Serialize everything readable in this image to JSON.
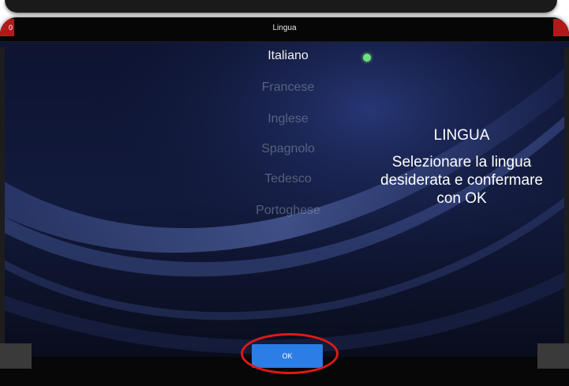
{
  "window": {
    "title": "Lingua",
    "left_badge": "0"
  },
  "languages": [
    {
      "label": "Italiano",
      "selected": true
    },
    {
      "label": "Francese",
      "selected": false
    },
    {
      "label": "Inglese",
      "selected": false
    },
    {
      "label": "Spagnolo",
      "selected": false
    },
    {
      "label": "Tedesco",
      "selected": false
    },
    {
      "label": "Portoghese",
      "selected": false
    }
  ],
  "help": {
    "title": "LINGUA",
    "body": "Selezionare la lingua desiderata e confermare con OK"
  },
  "footer": {
    "ok_label": "OK"
  },
  "colors": {
    "accent": "#2a7ee6",
    "selected_indicator": "#6fe07a",
    "highlight_ring": "#e01818",
    "warning_corner": "#b21a1a"
  }
}
